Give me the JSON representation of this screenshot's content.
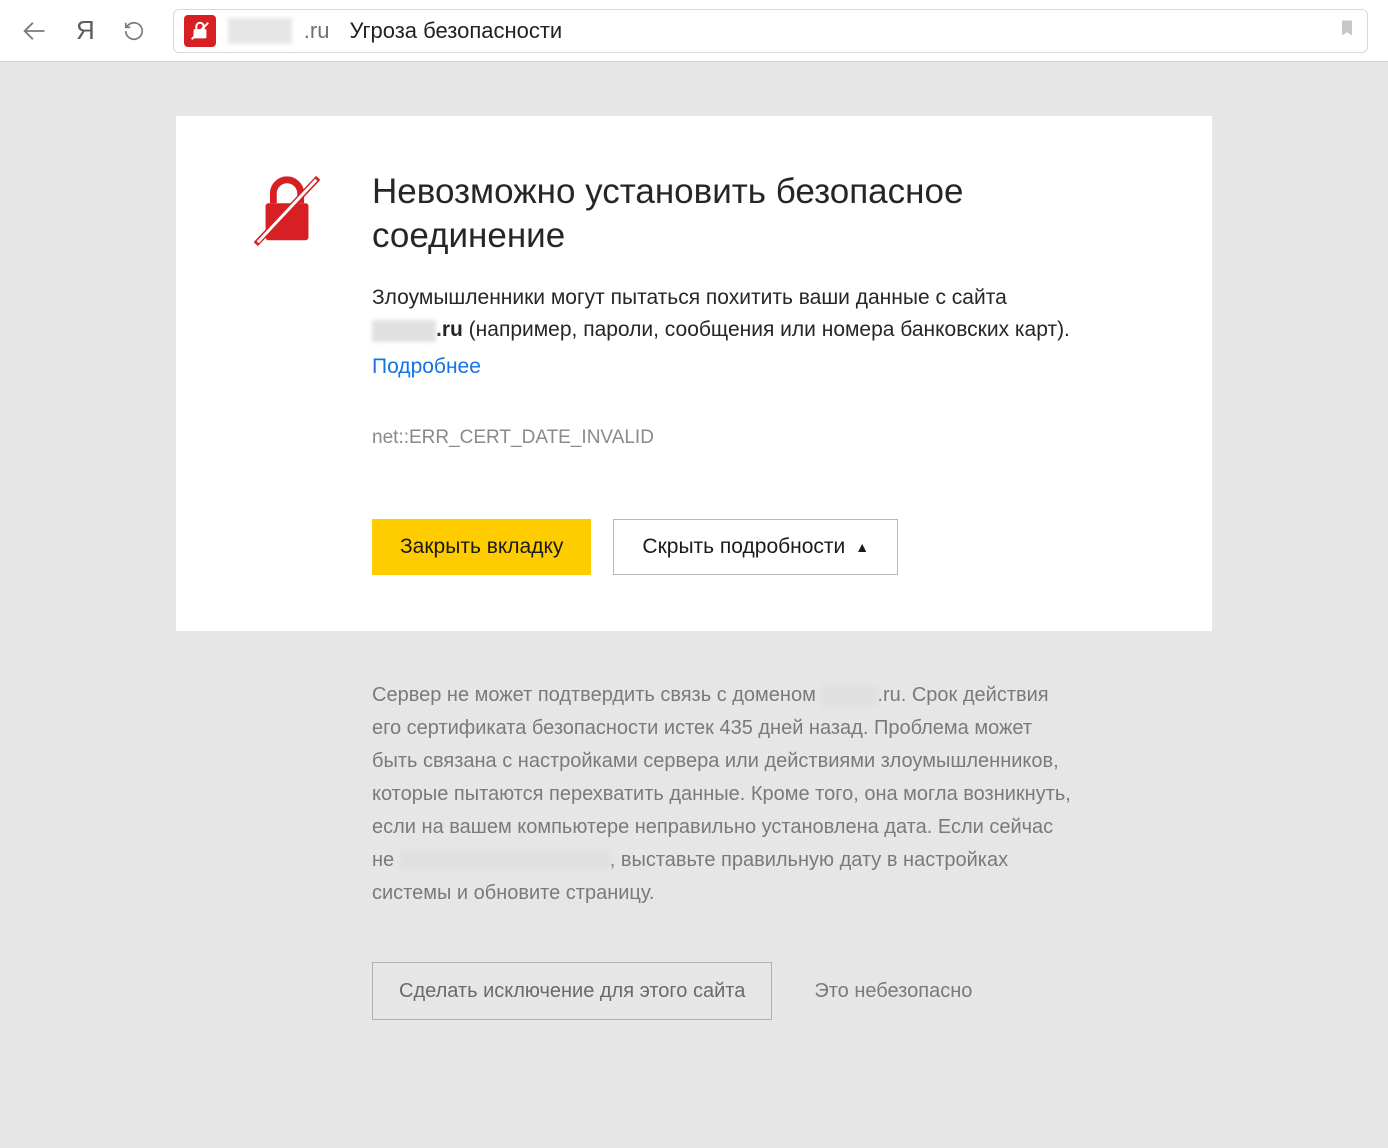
{
  "browser": {
    "domain_suffix": ".ru",
    "tab_title": "Угроза безопасности"
  },
  "warning": {
    "title": "Невозможно установить безопасное соединение",
    "body_before": "Злоумышленники могут пытаться похитить ваши данные с сайта",
    "body_domain_suffix": ".ru",
    "body_after": " (например, пароли, сообщения или номера банковских карт).",
    "details_link": "Подробнее",
    "error_code": "net::ERR_CERT_DATE_INVALID",
    "close_tab_button": "Закрыть вкладку",
    "hide_details_button": "Скрыть подробности"
  },
  "details": {
    "text_part1": "Сервер не может подтвердить связь с доменом ",
    "text_domain_suffix": ".ru",
    "text_part2": ". Срок действия его сертификата безопасности истек 435 дней назад. Проблема может быть связана с настройками сервера или действиями злоумышленников, которые пытаются перехватить данные. Кроме того, она могла возникнуть, если на вашем компьютере неправильно установлена дата. Если сейчас не ",
    "text_part3": ", выставьте правильную дату в настройках системы и обновите страницу.",
    "exception_button": "Сделать исключение для этого сайта",
    "unsafe_link": "Это небезопасно"
  }
}
